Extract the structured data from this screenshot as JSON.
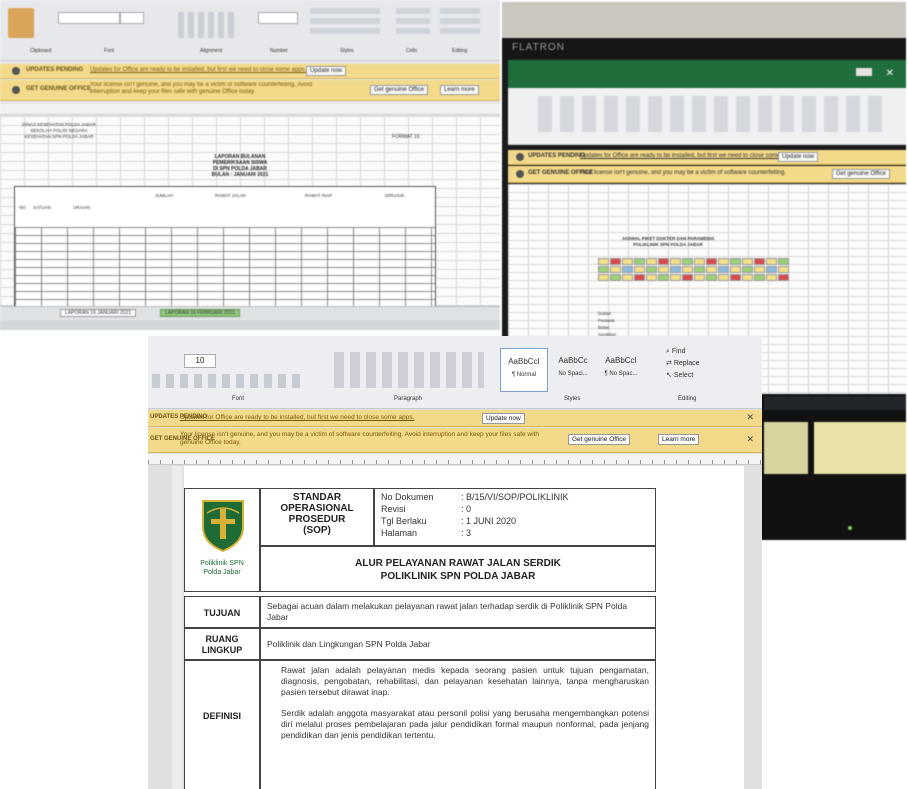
{
  "photo_left": {
    "ribbon_labels": [
      "Clipboard",
      "Font",
      "Alignment",
      "Number",
      "Styles",
      "Cells",
      "Editing"
    ],
    "warning_bar": {
      "label": "UPDATES PENDING",
      "text": "Updates for Office are ready to be installed, but first we need to close some apps.",
      "button": "Update now"
    },
    "notice_bar": {
      "label": "GET GENUINE OFFICE",
      "text": "Your license isn't genuine, and you may be a victim of software counterfeiting. Avoid interruption and keep your files safe with genuine Office today.",
      "buttons": [
        "Get genuine Office",
        "Learn more"
      ]
    },
    "header_left": [
      "DINAS KESEHATAN POLDA JABAR",
      "SEKOLAH POLISI NEGARA",
      "KESEHATAN SPN POLDA JABAR"
    ],
    "title": [
      "LAPORAN BULANAN",
      "PEMERIKSAAN SISWA",
      "DI SPN POLDA JABAR",
      "BULAN : JANUARI 2021"
    ],
    "code": "FORMAT 16",
    "column_headers": [
      "NO",
      "SATUAN",
      "URAIAN",
      "JUMLAH",
      "RAWAT JALAN",
      "RAWAT INAP",
      "DIRUJUK"
    ],
    "sheet_tabs": [
      "LAPORAN 16 JANUARI 2021",
      "LAPORAN 16 FEBRUARI 2021"
    ]
  },
  "photo_right": {
    "monitor_brand": "FLATRON",
    "warning_bar": {
      "label": "UPDATES PENDING",
      "text": "Updates for Office are ready to be installed, but first we need to close some apps.",
      "button": "Update now"
    },
    "notice_bar": {
      "label": "GET GENUINE OFFICE",
      "text": "Your license isn't genuine, and you may be a victim of software counterfeiting.",
      "button": "Get genuine Office"
    },
    "sheet_title": [
      "JADWAL PIKET DOKTER DAN PARAMEDIS",
      "POLIKLINIK SPN POLDA JABAR"
    ],
    "legend_items": [
      "Dokter",
      "Perawat",
      "Bidan",
      "Apoteker",
      "Analis"
    ]
  },
  "photo_bottom": {
    "ribbon": {
      "font_size": "10",
      "group_labels": [
        "Font",
        "Paragraph",
        "Styles",
        "Editing"
      ],
      "styles": [
        {
          "sample": "AaBbCcI",
          "name": "¶ Normal"
        },
        {
          "sample": "AaBbCc",
          "name": "No Spaci..."
        },
        {
          "sample": "AaBbCcI",
          "name": "¶ No Spac..."
        }
      ],
      "editing": [
        "Find",
        "Replace",
        "Select"
      ]
    },
    "warning_bar": {
      "label": "UPDATES PENDING",
      "text": "Updates for Office are ready to be installed, but first we need to close some apps.",
      "button": "Update now"
    },
    "notice_bar": {
      "label": "GET GENUINE OFFICE",
      "text": "Your license isn't genuine, and you may be a victim of software counterfeiting. Avoid interruption and keep your files safe with genuine Office today.",
      "buttons": [
        "Get genuine Office",
        "Learn more"
      ]
    },
    "sop": {
      "logo_caption": [
        "Poliklinik SPN",
        "Polda Jabar"
      ],
      "doc_type": [
        "STANDAR",
        "OPERASIONAL",
        "PROSEDUR",
        "(SOP)"
      ],
      "meta": [
        {
          "label": "No Dokumen",
          "value": ": B/15/VI/SOP/POLIKLINIK"
        },
        {
          "label": "Revisi",
          "value": ": 0"
        },
        {
          "label": "Tgl Berlaku",
          "value": ": 1 JUNI 2020"
        },
        {
          "label": "Halaman",
          "value": ": 3"
        }
      ],
      "title": [
        "ALUR PELAYANAN RAWAT JALAN SERDIK",
        "POLIKLINIK SPN POLDA JABAR"
      ],
      "rows": [
        {
          "label": "TUJUAN",
          "text": "Sebagai acuan dalam melakukan pelayanan rawat jalan terhadap serdik di Poliklinik SPN Polda Jabar"
        },
        {
          "label": "RUANG LINGKUP",
          "text": "Poliklinik dan Lingkungan SPN Polda Jabar"
        },
        {
          "label": "DEFINISI",
          "paragraphs": [
            "Rawat jalan adalah pelayanan medis kepada seorang pasien untuk tujuan pengamatan, diagnosis, pengobatan, rehabilitasi, dan pelayanan kesehatan lainnya, tanpa mengharuskan pasien tersebut dirawat inap.",
            "Serdik adalah anggota masyarakat atau personil polisi yang berusaha mengembangkan potensi diri melalui proses pembelajaran pada jalur pendidikan formal maupun nonformal, pada jenjang pendidikan dan jenis pendidikan tertentu."
          ]
        }
      ]
    }
  },
  "colors": {
    "warning_bar": "#f3d98a",
    "logo_green": "#1e6b35",
    "logo_gold": "#d8b236",
    "monitor_bezel": "#1a1a1a"
  }
}
